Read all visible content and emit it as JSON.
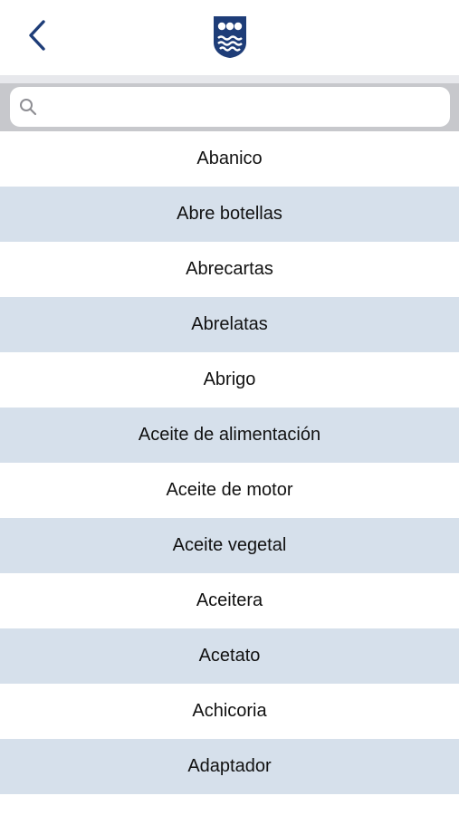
{
  "nav": {
    "back_icon": "chevron-left-icon",
    "logo_icon": "coat-of-arms-icon",
    "accent_color": "#1e3d78"
  },
  "search": {
    "icon": "search-icon",
    "value": "",
    "placeholder": ""
  },
  "colors": {
    "row_alt": "#d6e0eb",
    "row": "#ffffff",
    "search_bar_bg": "#c7c8cc"
  },
  "items": [
    "Abanico",
    "Abre botellas",
    "Abrecartas",
    "Abrelatas",
    "Abrigo",
    "Aceite de alimentación",
    "Aceite de motor",
    "Aceite vegetal",
    "Aceitera",
    "Acetato",
    "Achicoria",
    "Adaptador"
  ]
}
